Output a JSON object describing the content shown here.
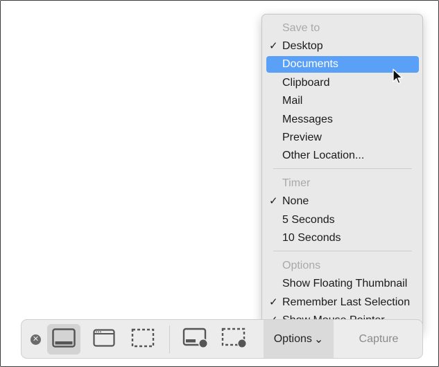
{
  "menu": {
    "sections": [
      {
        "header": "Save to",
        "items": [
          {
            "label": "Desktop",
            "checked": true
          },
          {
            "label": "Documents",
            "checked": false,
            "highlighted": true
          },
          {
            "label": "Clipboard",
            "checked": false
          },
          {
            "label": "Mail",
            "checked": false
          },
          {
            "label": "Messages",
            "checked": false
          },
          {
            "label": "Preview",
            "checked": false
          },
          {
            "label": "Other Location...",
            "checked": false
          }
        ]
      },
      {
        "header": "Timer",
        "items": [
          {
            "label": "None",
            "checked": true
          },
          {
            "label": "5 Seconds",
            "checked": false
          },
          {
            "label": "10 Seconds",
            "checked": false
          }
        ]
      },
      {
        "header": "Options",
        "items": [
          {
            "label": "Show Floating Thumbnail",
            "checked": false
          },
          {
            "label": "Remember Last Selection",
            "checked": true
          },
          {
            "label": "Show Mouse Pointer",
            "checked": true
          }
        ]
      }
    ],
    "check_glyph": "✓",
    "highlight_color": "#5aa0f7"
  },
  "toolbar": {
    "close_glyph": "✕",
    "options_label": "Options",
    "options_caret": "⌄",
    "capture_label": "Capture",
    "icons": [
      "capture-entire-screen-icon",
      "capture-selected-window-icon",
      "capture-selected-portion-icon",
      "record-entire-screen-icon",
      "record-selected-portion-icon"
    ]
  }
}
